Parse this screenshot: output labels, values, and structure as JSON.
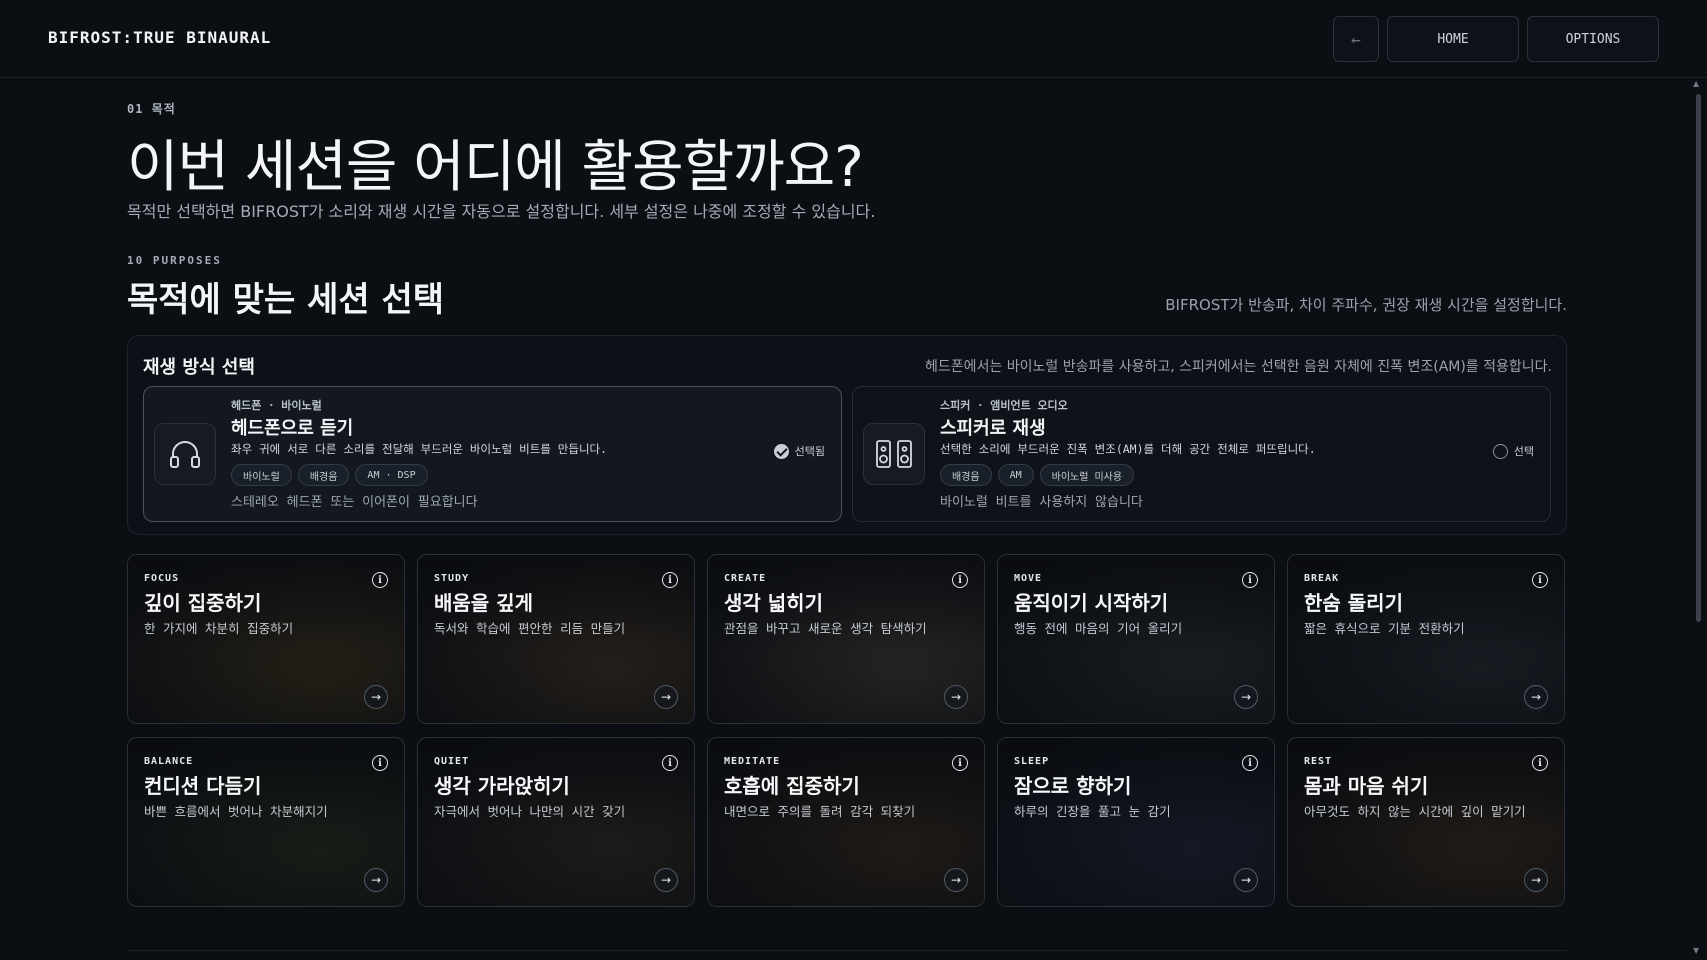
{
  "app": {
    "brand": "BIFROST:TRUE BINAURAL"
  },
  "nav": {
    "back_icon": "←",
    "home": "HOME",
    "options": "OPTIONS"
  },
  "intro": {
    "step": "01 목적",
    "title": "이번 세션을 어디에 활용할까요?",
    "description": "목적만 선택하면 BIFROST가 소리와 재생 시간을 자동으로 설정합니다. 세부 설정은 나중에 조정할 수 있습니다.",
    "purposes_label": "10 PURPOSES",
    "section_title": "목적에 맞는 세션 선택",
    "section_note": "BIFROST가 반송파, 차이 주파수, 권장 재생 시간을 설정합니다."
  },
  "playback": {
    "title": "재생 방식 선택",
    "description": "헤드폰에서는 바이노럴 반송파를 사용하고, 스피커에서는 선택한 음원 자체에 진폭 변조(AM)를 적용합니다.",
    "modes": [
      {
        "kicker": "헤드폰 · 바이노럴",
        "title": "헤드폰으로 듣기",
        "desc": "좌우 귀에 서로 다른 소리를 전달해 부드러운 바이노럴 비트를 만듭니다.",
        "tags": [
          "바이노럴",
          "배경음",
          "AM · DSP"
        ],
        "note": "스테레오 헤드폰 또는 이어폰이 필요합니다",
        "select_label": "선택됨",
        "selected": true,
        "icon": "headphones-icon"
      },
      {
        "kicker": "스피커 · 앰비언트 오디오",
        "title": "스피커로 재생",
        "desc": "선택한 소리에 부드러운 진폭 변조(AM)를 더해 공간 전체로 퍼뜨립니다.",
        "tags": [
          "배경음",
          "AM",
          "바이노럴 미사용"
        ],
        "note": "바이노럴 비트를 사용하지 않습니다",
        "select_label": "선택",
        "selected": false,
        "icon": "speakers-icon"
      }
    ]
  },
  "purposes": [
    {
      "code": "FOCUS",
      "title": "깊이 집중하기",
      "desc": "한 가지에 차분히 집중하기",
      "bg": "#2a2418"
    },
    {
      "code": "STUDY",
      "title": "배움을 깊게",
      "desc": "독서와 학습에 편안한 리듬 만들기",
      "bg": "#2b241c"
    },
    {
      "code": "CREATE",
      "title": "생각 넓히기",
      "desc": "관점을 바꾸고 새로운 생각 탐색하기",
      "bg": "#2c2a27"
    },
    {
      "code": "MOVE",
      "title": "움직이기 시작하기",
      "desc": "행동 전에 마음의 기어 올리기",
      "bg": "#1d2126"
    },
    {
      "code": "BREAK",
      "title": "한숨 돌리기",
      "desc": "짧은 휴식으로 기분 전환하기",
      "bg": "#1a2026"
    },
    {
      "code": "BALANCE",
      "title": "컨디션 다듬기",
      "desc": "바쁜 흐름에서 벗어나 차분해지기",
      "bg": "#1c2118"
    },
    {
      "code": "QUIET",
      "title": "생각 가라앉히기",
      "desc": "자극에서 벗어나 나만의 시간 갖기",
      "bg": "#221f1c"
    },
    {
      "code": "MEDITATE",
      "title": "호흡에 집중하기",
      "desc": "내면으로 주의를 돌려 감각 되찾기",
      "bg": "#241e18"
    },
    {
      "code": "SLEEP",
      "title": "잠으로 향하기",
      "desc": "하루의 긴장을 풀고 눈 감기",
      "bg": "#161c2a"
    },
    {
      "code": "REST",
      "title": "몸과 마음 쉬기",
      "desc": "아무것도 하지 않는 시간에 깊이 맡기기",
      "bg": "#261f18"
    }
  ]
}
